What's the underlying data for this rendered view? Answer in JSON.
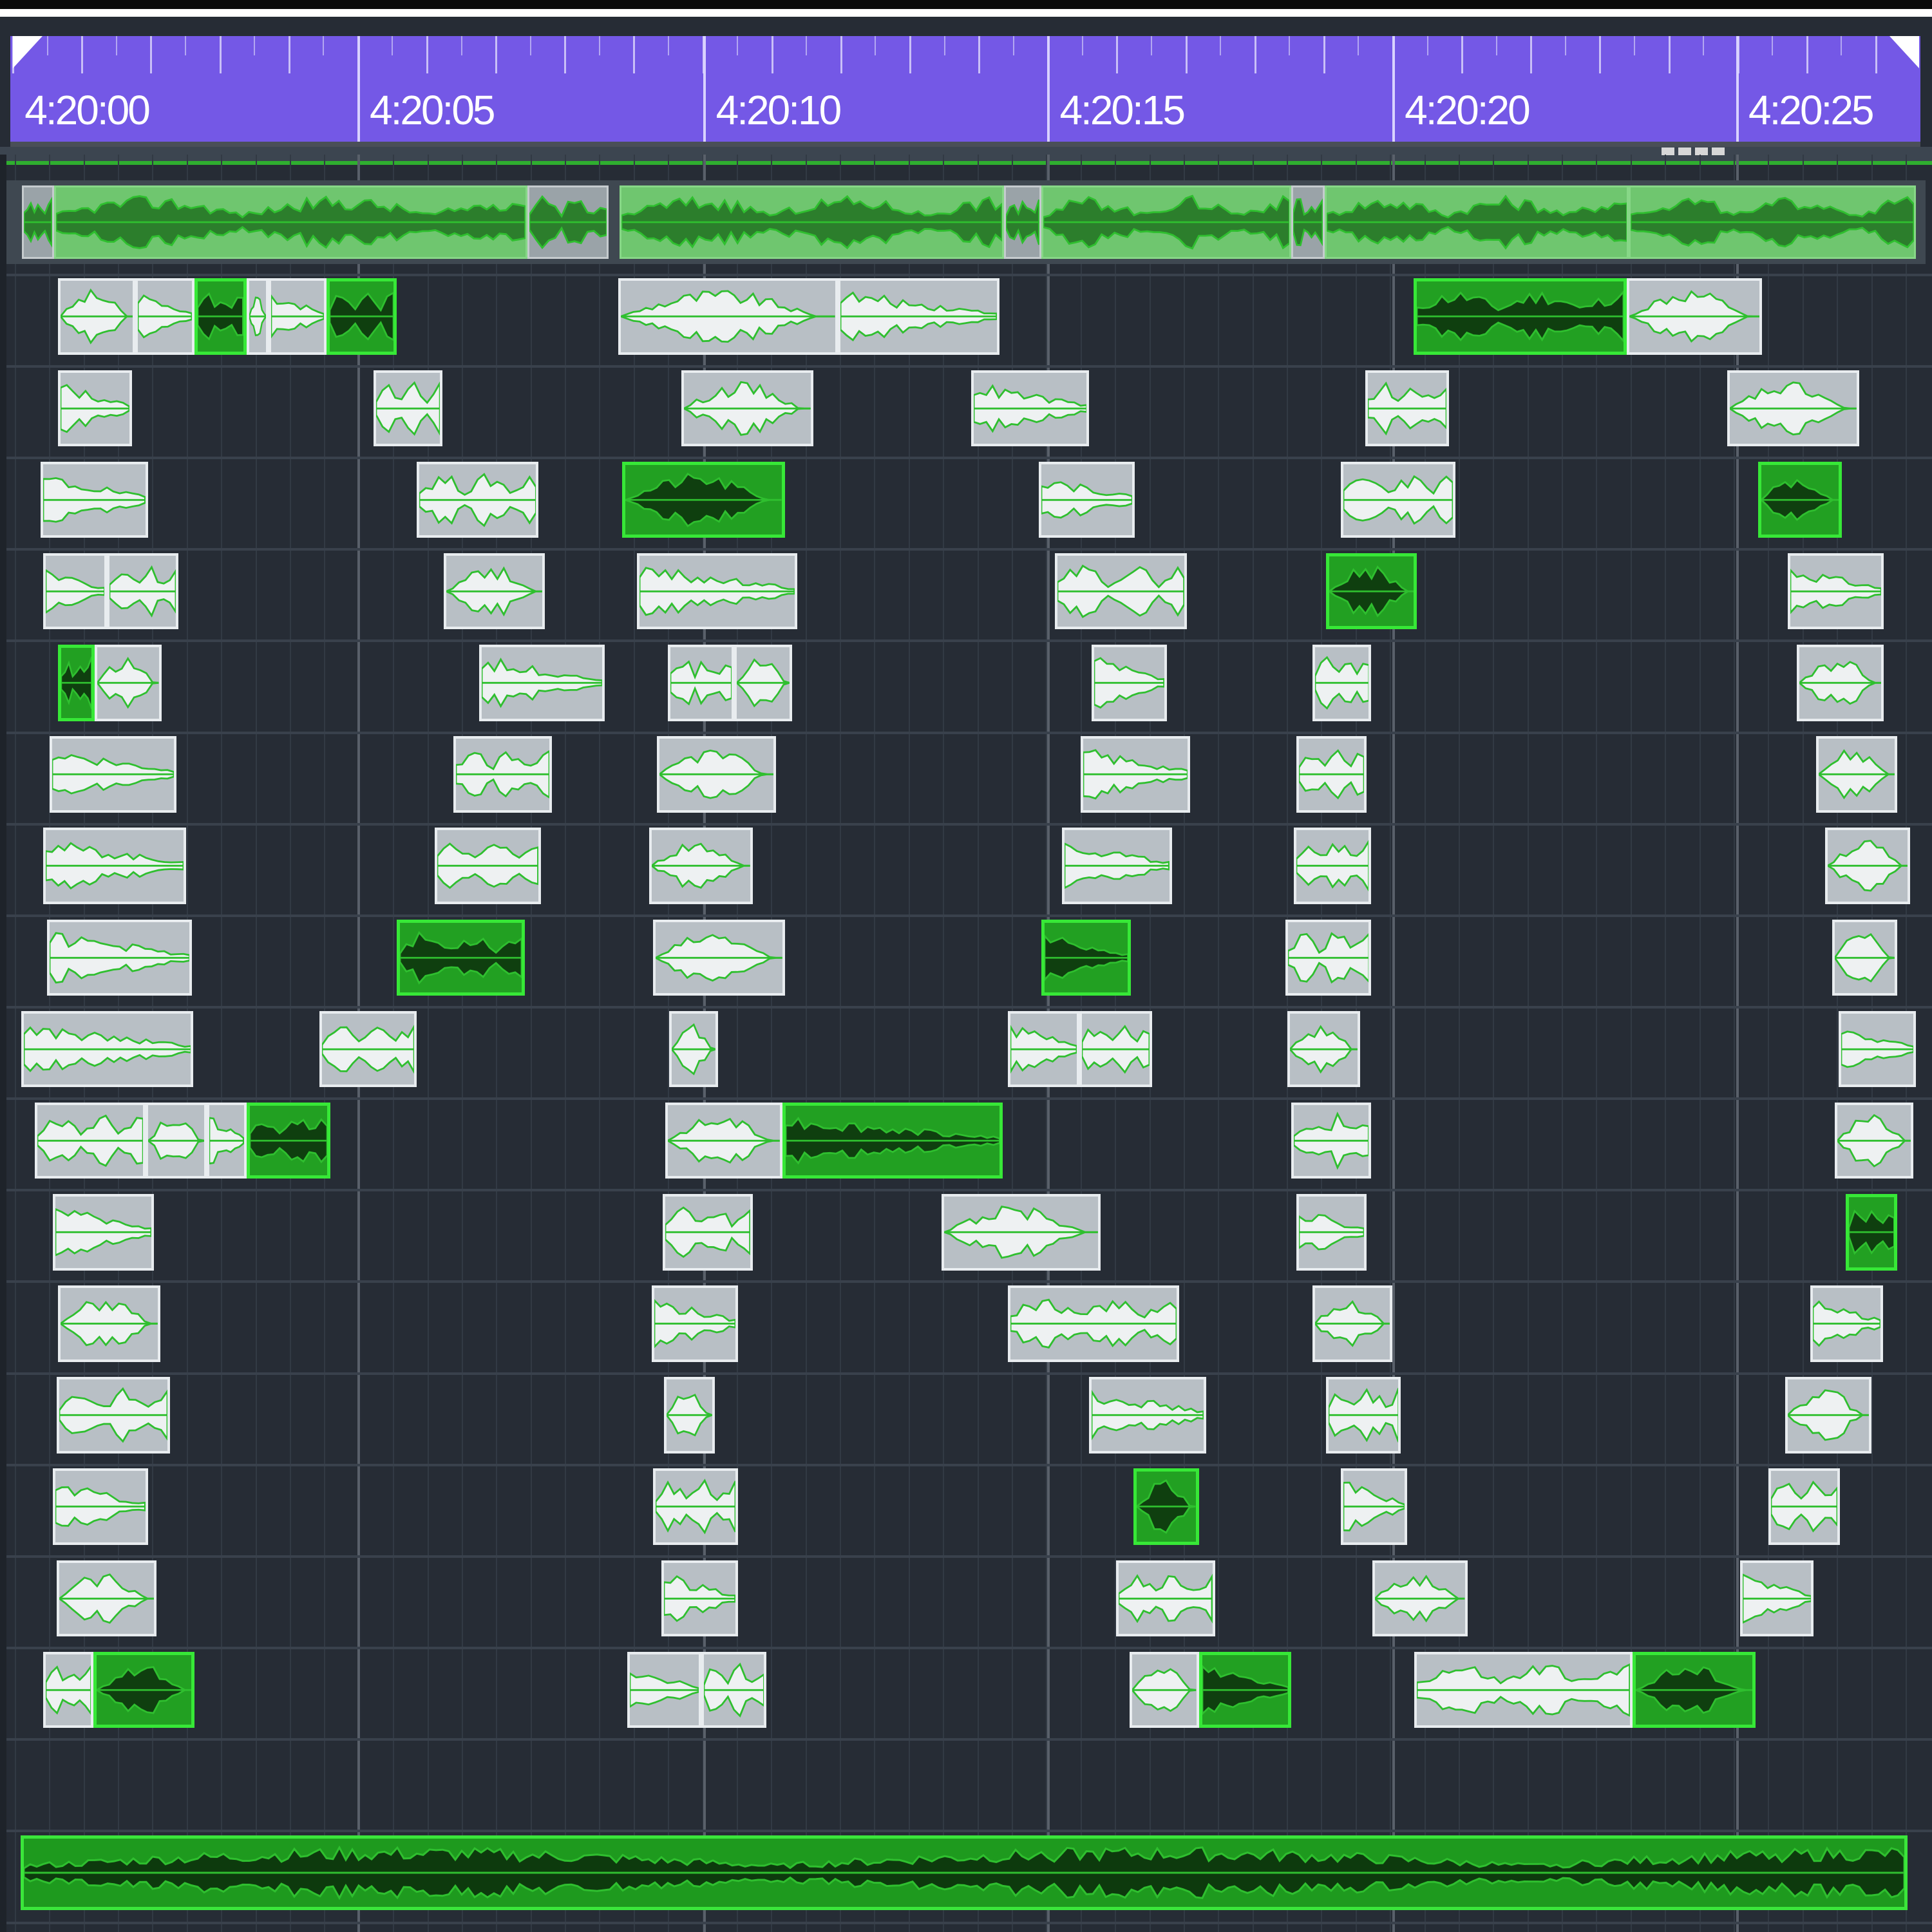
{
  "timeline": {
    "ruler_labels": [
      "4:20:00",
      "4:20:05",
      "4:20:10",
      "4:20:15",
      "4:20:20",
      "4:20:25"
    ]
  },
  "colors": {
    "ruler": "#7458e6",
    "background": "#262c35",
    "clip_gray": "#b8bfc5",
    "clip_green": "#22a022",
    "waveform_light": "#eef1f2",
    "waveform_dark": "#0f3f0f"
  },
  "icons": [
    "loop-start-marker-icon",
    "loop-end-marker-icon",
    "scroll-grip-icon"
  ]
}
